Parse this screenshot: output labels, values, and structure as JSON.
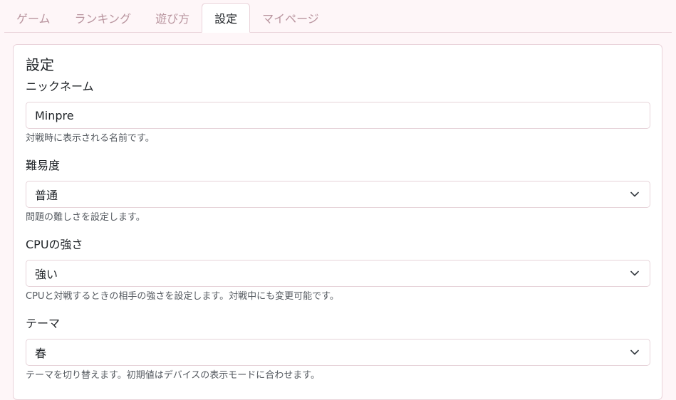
{
  "tabs": [
    {
      "label": "ゲーム",
      "active": false
    },
    {
      "label": "ランキング",
      "active": false
    },
    {
      "label": "遊び方",
      "active": false
    },
    {
      "label": "設定",
      "active": true
    },
    {
      "label": "マイページ",
      "active": false
    }
  ],
  "settings": {
    "title": "設定",
    "nickname": {
      "label": "ニックネーム",
      "value": "Minpre",
      "help": "対戦時に表示される名前です。"
    },
    "difficulty": {
      "label": "難易度",
      "value": "普通",
      "help": "問題の難しさを設定します。"
    },
    "cpu_strength": {
      "label": "CPUの強さ",
      "value": "強い",
      "help": "CPUと対戦するときの相手の強さを設定します。対戦中にも変更可能です。"
    },
    "theme": {
      "label": "テーマ",
      "value": "春",
      "help": "テーマを切り替えます。初期値はデバイスの表示モードに合わせます。"
    }
  },
  "icons": {
    "select_chevron": "chevron-down-icon"
  },
  "colors": {
    "page_background": "#fef6f8",
    "border": "#ead3da",
    "inactive_tab": "#b9959f",
    "text": "#212529",
    "help_text": "#555a60"
  }
}
